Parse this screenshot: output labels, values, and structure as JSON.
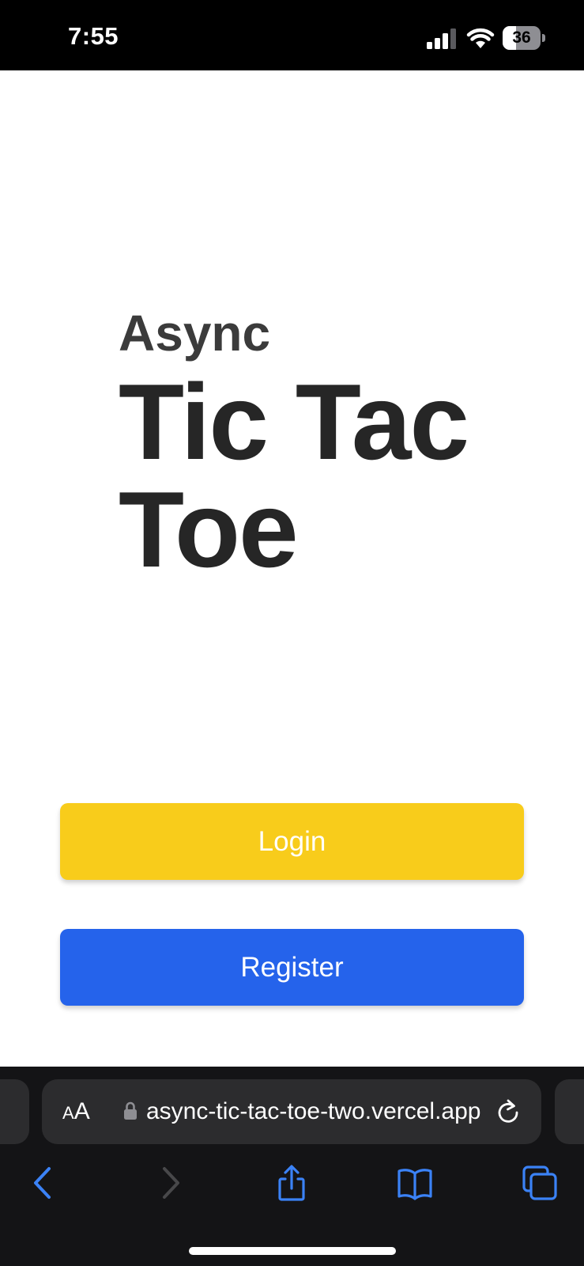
{
  "status_bar": {
    "time": "7:55",
    "battery_level": "36",
    "battery_fraction": 0.36,
    "signal_icon": "cellular-signal-icon",
    "wifi_icon": "wifi-icon",
    "battery_icon": "battery-icon"
  },
  "hero": {
    "subtitle": "Async",
    "title": "Tic Tac Toe"
  },
  "actions": {
    "login_label": "Login",
    "register_label": "Register"
  },
  "browser": {
    "reader_small": "A",
    "reader_large": "A",
    "url": "async-tic-tac-toe-two.vercel.app",
    "lock_icon": "lock-icon",
    "reload_icon": "reload-icon",
    "toolbar": [
      {
        "icon": "back-chevron-icon",
        "enabled": true
      },
      {
        "icon": "forward-chevron-icon",
        "enabled": false
      },
      {
        "icon": "share-icon",
        "enabled": true
      },
      {
        "icon": "bookmarks-icon",
        "enabled": true
      },
      {
        "icon": "tabs-icon",
        "enabled": true
      }
    ]
  },
  "colors": {
    "login_button": "#f8cc1b",
    "register_button": "#2563eb",
    "title_text": "#262626",
    "safari_accent": "#3b82f6",
    "chrome_background": "#141416"
  }
}
